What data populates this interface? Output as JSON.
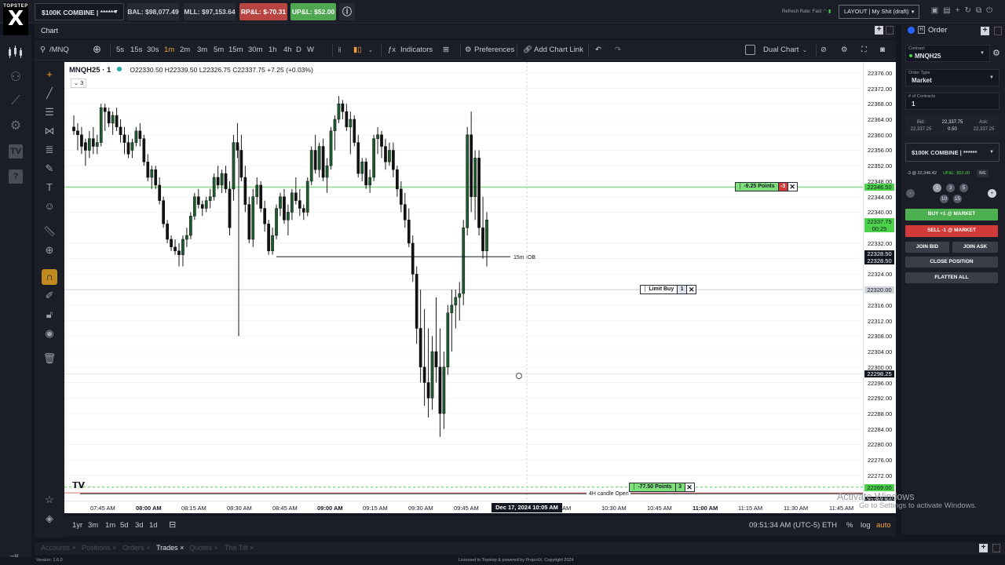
{
  "topbar": {
    "logo_top": "TOPSTEP",
    "logo_letter": "X",
    "account_selector": "$100K COMBINE | ******",
    "balance": "BAL: $98,077.49",
    "mll": "MLL: $97,153.64",
    "rpl": "RP&L: $-70.31",
    "upl": "UP&L: $52.00",
    "refresh_rate": "Refresh Rate: Fast",
    "layout": "LAYOUT | My Shit (draft)"
  },
  "chart_tab": {
    "label": "Chart"
  },
  "chart_toolbar": {
    "symbol": "/MNQ",
    "intervals": [
      "5s",
      "15s",
      "30s",
      "1m",
      "2m",
      "3m",
      "5m",
      "15m",
      "30m",
      "1h",
      "4h",
      "D",
      "W"
    ],
    "active_interval": "1m",
    "indicators": "Indicators",
    "preferences": "Preferences",
    "add_chart_link": "Add Chart Link",
    "dual_chart": "Dual Chart"
  },
  "legend": {
    "symbol": "MNQH25 · 1",
    "ohlc": "O22330.50 H22339.50 L22326.75 C22337.75 +7.25 (+0.03%)",
    "collapsed_count": "3"
  },
  "chart_data": {
    "type": "candlestick",
    "symbol": "MNQH25",
    "timeframe": "1m",
    "x_ticks": [
      "07:45 AM",
      "08:00 AM",
      "08:15 AM",
      "08:30 AM",
      "08:45 AM",
      "09:00 AM",
      "09:15 AM",
      "09:30 AM",
      "09:45 AM",
      "10:30 AM",
      "10:45 AM",
      "11:00 AM",
      "11:15 AM",
      "11:30 AM",
      "11:45 AM"
    ],
    "bold_x_ticks": [
      "08:00 AM",
      "09:00 AM",
      "11:00 AM"
    ],
    "y_ticks": [
      22376,
      22372,
      22368,
      22364,
      22360,
      22356,
      22352,
      22348,
      22344,
      22340,
      22332,
      22328,
      22324,
      22316,
      22312,
      22308,
      22304,
      22300,
      22296,
      22292,
      22288,
      22284,
      22280,
      22276,
      22272
    ],
    "ylim": [
      22265.5,
      22378.8
    ],
    "crosshair_date": "Dec 17, 2024   10:05 AM",
    "price_tags": [
      {
        "value": "22346.50",
        "color": "#4cd14a"
      },
      {
        "value": "22337.75",
        "sub": "00:25",
        "color": "#4cd14a"
      },
      {
        "value": "22328.50",
        "color": "#131722"
      },
      {
        "value": "22328.50",
        "color": "#131722"
      },
      {
        "value": "22320.00",
        "color": "#d1d4dc"
      },
      {
        "value": "22298.25",
        "color": "#131722"
      },
      {
        "value": "22269.00",
        "color": "#4cd14a"
      },
      {
        "value": "22267.50",
        "color": "#131722"
      }
    ],
    "annotations": [
      {
        "text": "15m -OB",
        "price": 22328.5
      },
      {
        "text": "4H candle Open",
        "price": 22267.5
      }
    ],
    "orders": [
      {
        "label": "-9.25 Points",
        "qty": "-3",
        "price": 22346.5,
        "type": "position"
      },
      {
        "label": "Limit Buy",
        "qty": "1",
        "price": 22320.0,
        "type": "limit"
      },
      {
        "label": "-77.50 Points",
        "qty": "3",
        "price": 22269.0,
        "type": "stop"
      }
    ],
    "horizontal_lines": [
      22346.5,
      22328.5,
      22320.0,
      22298.25,
      22269.0,
      22267.5
    ],
    "candles": [
      [
        22362,
        22365,
        22360,
        22361
      ],
      [
        22361,
        22363,
        22356,
        22360
      ],
      [
        22360,
        22362,
        22355,
        22357
      ],
      [
        22358,
        22359,
        22352,
        22356
      ],
      [
        22356,
        22361,
        22354,
        22359
      ],
      [
        22359,
        22362,
        22355,
        22357
      ],
      [
        22357,
        22360,
        22355,
        22358
      ],
      [
        22358,
        22368,
        22357,
        22367
      ],
      [
        22367,
        22368,
        22361,
        22366
      ],
      [
        22366,
        22367,
        22362,
        22363
      ],
      [
        22363,
        22366,
        22360,
        22365
      ],
      [
        22365,
        22367,
        22361,
        22362
      ],
      [
        22362,
        22364,
        22358,
        22360
      ],
      [
        22360,
        22362,
        22355,
        22358
      ],
      [
        22358,
        22360,
        22354,
        22355
      ],
      [
        22356,
        22359,
        22354,
        22358
      ],
      [
        22358,
        22362,
        22357,
        22361
      ],
      [
        22361,
        22363,
        22357,
        22359
      ],
      [
        22359,
        22360,
        22352,
        22353
      ],
      [
        22353,
        22355,
        22348,
        22349
      ],
      [
        22349,
        22352,
        22346,
        22351
      ],
      [
        22351,
        22352,
        22346,
        22347
      ],
      [
        22347,
        22349,
        22342,
        22343
      ],
      [
        22343,
        22344,
        22336,
        22337
      ],
      [
        22337,
        22338,
        22332,
        22333
      ],
      [
        22333,
        22334,
        22330,
        22331
      ],
      [
        22331,
        22333,
        22329,
        22330
      ],
      [
        22330,
        22332,
        22326,
        22329
      ],
      [
        22329,
        22334,
        22326,
        22333
      ],
      [
        22333,
        22336,
        22331,
        22334
      ],
      [
        22334,
        22340,
        22333,
        22339
      ],
      [
        22339,
        22345,
        22338,
        22344
      ],
      [
        22344,
        22346,
        22341,
        22342
      ],
      [
        22342,
        22343,
        22339,
        22341
      ],
      [
        22341,
        22344,
        22340,
        22343
      ],
      [
        22343,
        22346,
        22341,
        22344
      ],
      [
        22344,
        22350,
        22343,
        22349
      ],
      [
        22349,
        22352,
        22346,
        22347
      ],
      [
        22347,
        22351,
        22345,
        22350
      ],
      [
        22350,
        22352,
        22345,
        22346
      ],
      [
        22346,
        22348,
        22334,
        22336
      ],
      [
        22346,
        22360,
        22343,
        22358
      ],
      [
        22358,
        22363,
        22354,
        22356
      ],
      [
        22356,
        22360,
        22348,
        22349
      ],
      [
        22349,
        22352,
        22340,
        22342
      ],
      [
        22342,
        22344,
        22332,
        22333
      ],
      [
        22333,
        22346,
        22331,
        22344
      ],
      [
        22344,
        22349,
        22342,
        22347
      ],
      [
        22347,
        22348,
        22340,
        22341
      ],
      [
        22341,
        22343,
        22335,
        22337
      ],
      [
        22337,
        22338,
        22329,
        22330
      ],
      [
        22330,
        22336,
        22329,
        22334
      ],
      [
        22334,
        22342,
        22333,
        22341
      ],
      [
        22341,
        22345,
        22339,
        22344
      ],
      [
        22344,
        22346,
        22337,
        22338
      ],
      [
        22338,
        22342,
        22334,
        22340
      ],
      [
        22340,
        22346,
        22338,
        22345
      ],
      [
        22345,
        22349,
        22342,
        22343
      ],
      [
        22343,
        22346,
        22339,
        22341
      ],
      [
        22341,
        22342,
        22338,
        22340
      ],
      [
        22340,
        22349,
        22339,
        22348
      ],
      [
        22348,
        22357,
        22347,
        22356
      ],
      [
        22356,
        22360,
        22350,
        22351
      ],
      [
        22351,
        22358,
        22349,
        22357
      ],
      [
        22357,
        22359,
        22348,
        22349
      ],
      [
        22349,
        22354,
        22345,
        22352
      ],
      [
        22352,
        22362,
        22351,
        22361
      ],
      [
        22361,
        22365,
        22356,
        22364
      ],
      [
        22364,
        22370,
        22363,
        22368
      ],
      [
        22368,
        22369,
        22364,
        22366
      ],
      [
        22366,
        22368,
        22361,
        22362
      ],
      [
        22362,
        22366,
        22355,
        22364
      ],
      [
        22364,
        22365,
        22357,
        22358
      ],
      [
        22358,
        22360,
        22349,
        22350
      ],
      [
        22350,
        22354,
        22348,
        22353
      ],
      [
        22353,
        22354,
        22346,
        22347
      ],
      [
        22347,
        22351,
        22345,
        22349
      ],
      [
        22349,
        22360,
        22348,
        22359
      ],
      [
        22359,
        22362,
        22355,
        22360
      ],
      [
        22360,
        22361,
        22354,
        22357
      ],
      [
        22357,
        22359,
        22351,
        22353
      ],
      [
        22353,
        22358,
        22352,
        22356
      ],
      [
        22356,
        22358,
        22349,
        22351
      ],
      [
        22351,
        22352,
        22344,
        22346
      ],
      [
        22346,
        22348,
        22340,
        22342
      ],
      [
        22342,
        22345,
        22336,
        22338
      ],
      [
        22338,
        22341,
        22331,
        22332
      ],
      [
        22332,
        22334,
        22322,
        22324
      ],
      [
        22324,
        22326,
        22306,
        22310
      ],
      [
        22310,
        22320,
        22296,
        22300
      ],
      [
        22300,
        22315,
        22290,
        22296
      ],
      [
        22296,
        22310,
        22287,
        22292
      ],
      [
        22292,
        22308,
        22289,
        22304
      ],
      [
        22304,
        22318,
        22296,
        22300
      ],
      [
        22300,
        22310,
        22282,
        22288
      ],
      [
        22288,
        22304,
        22284,
        22300
      ],
      [
        22300,
        22316,
        22298,
        22314
      ],
      [
        22314,
        22320,
        22304,
        22316
      ],
      [
        22316,
        22320,
        22310,
        22318
      ],
      [
        22318,
        22322,
        22312,
        22319
      ],
      [
        22319,
        22338,
        22316,
        22336
      ],
      [
        22336,
        22362,
        22334,
        22360
      ],
      [
        22360,
        22366,
        22340,
        22344
      ],
      [
        22344,
        22356,
        22338,
        22354
      ],
      [
        22354,
        22356,
        22334,
        22336
      ],
      [
        22336,
        22344,
        22328,
        22330
      ],
      [
        22330,
        22340,
        22326,
        22338
      ]
    ]
  },
  "bottombar": {
    "ranges": [
      "1yr",
      "3m",
      "1m",
      "5d",
      "3d",
      "1d"
    ],
    "time": "09:51:34 AM (UTC-5)",
    "session": "ETH",
    "pct": "%",
    "log": "log",
    "auto": "auto"
  },
  "order_panel": {
    "title": "Order",
    "contract_label": "Contract",
    "contract": "MNQH25",
    "order_type_label": "Order Type",
    "order_type": "Market",
    "contracts_label": "# of Contracts",
    "contracts": "1",
    "bid_label": "Bid:",
    "bid": "22,337.25",
    "mid": "22,337.75",
    "spread": "0.50",
    "ask_label": "Ask:",
    "ask": "22,337.25",
    "account": "$100K COMBINE | ******",
    "position": "-3 @ 22,346.42",
    "position_upl": "UP&L: $52.00",
    "be": "B/E",
    "qty_presets": [
      "1",
      "3",
      "5",
      "10",
      "15"
    ],
    "buy_market": "BUY +1 @ MARKET",
    "sell_market": "SELL -1 @ MARKET",
    "join_bid": "JOIN BID",
    "join_ask": "JOIN ASK",
    "close_position": "CLOSE POSITION",
    "flatten_all": "FLATTEN ALL"
  },
  "bottom_tabs": [
    "Accounts",
    "Positions",
    "Orders",
    "Trades",
    "Quotes",
    "The Tilt"
  ],
  "active_bottom_tab": "Trades",
  "footer": {
    "version": "Version: 1.6.0",
    "copyright": "Licensed to Topstep & powered by ProjectX. Copyright 2024"
  },
  "watermark": {
    "line1": "Activate Windows",
    "line2": "Go to Settings to activate Windows."
  }
}
